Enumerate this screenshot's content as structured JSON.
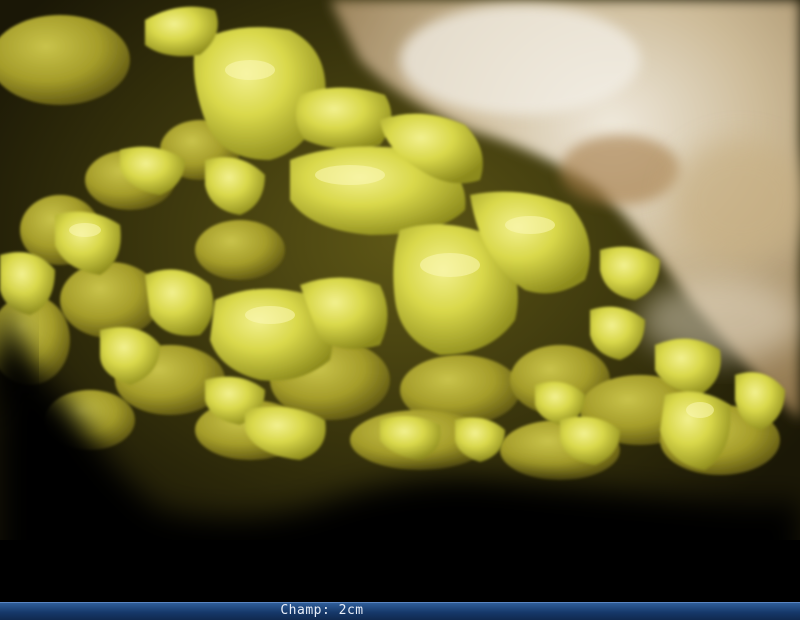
{
  "image": {
    "subject": "sulfur-crystals-macro-photo",
    "colors": {
      "crystal": "#d7d64a",
      "crystal_highlight": "#f0ee8a",
      "crystal_shadow": "#7a7a18",
      "matrix": "#c9b79a",
      "background": "#000000"
    }
  },
  "caption": {
    "text": "Champ: 2cm",
    "bar_color": "#1e4580"
  }
}
